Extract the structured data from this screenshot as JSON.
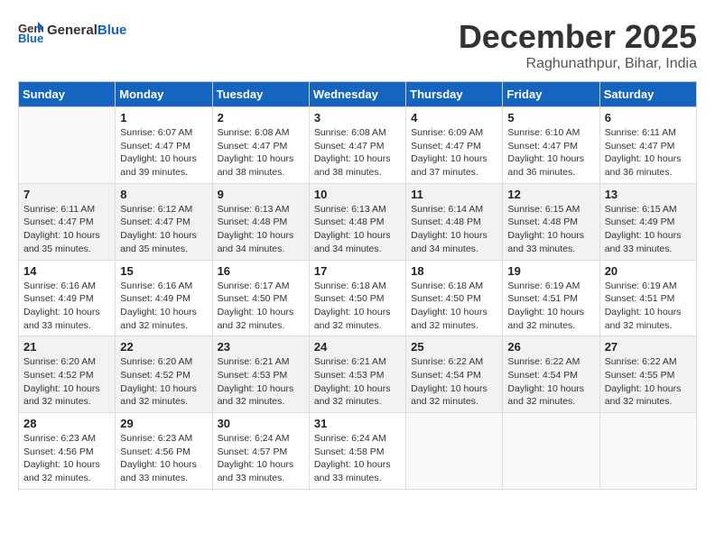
{
  "logo": {
    "general": "General",
    "blue": "Blue"
  },
  "title": "December 2025",
  "location": "Raghunathpur, Bihar, India",
  "weekdays": [
    "Sunday",
    "Monday",
    "Tuesday",
    "Wednesday",
    "Thursday",
    "Friday",
    "Saturday"
  ],
  "weeks": [
    [
      {
        "day": "",
        "sunrise": "",
        "sunset": "",
        "daylight": ""
      },
      {
        "day": "1",
        "sunrise": "Sunrise: 6:07 AM",
        "sunset": "Sunset: 4:47 PM",
        "daylight": "Daylight: 10 hours and 39 minutes."
      },
      {
        "day": "2",
        "sunrise": "Sunrise: 6:08 AM",
        "sunset": "Sunset: 4:47 PM",
        "daylight": "Daylight: 10 hours and 38 minutes."
      },
      {
        "day": "3",
        "sunrise": "Sunrise: 6:08 AM",
        "sunset": "Sunset: 4:47 PM",
        "daylight": "Daylight: 10 hours and 38 minutes."
      },
      {
        "day": "4",
        "sunrise": "Sunrise: 6:09 AM",
        "sunset": "Sunset: 4:47 PM",
        "daylight": "Daylight: 10 hours and 37 minutes."
      },
      {
        "day": "5",
        "sunrise": "Sunrise: 6:10 AM",
        "sunset": "Sunset: 4:47 PM",
        "daylight": "Daylight: 10 hours and 36 minutes."
      },
      {
        "day": "6",
        "sunrise": "Sunrise: 6:11 AM",
        "sunset": "Sunset: 4:47 PM",
        "daylight": "Daylight: 10 hours and 36 minutes."
      }
    ],
    [
      {
        "day": "7",
        "sunrise": "Sunrise: 6:11 AM",
        "sunset": "Sunset: 4:47 PM",
        "daylight": "Daylight: 10 hours and 35 minutes."
      },
      {
        "day": "8",
        "sunrise": "Sunrise: 6:12 AM",
        "sunset": "Sunset: 4:47 PM",
        "daylight": "Daylight: 10 hours and 35 minutes."
      },
      {
        "day": "9",
        "sunrise": "Sunrise: 6:13 AM",
        "sunset": "Sunset: 4:48 PM",
        "daylight": "Daylight: 10 hours and 34 minutes."
      },
      {
        "day": "10",
        "sunrise": "Sunrise: 6:13 AM",
        "sunset": "Sunset: 4:48 PM",
        "daylight": "Daylight: 10 hours and 34 minutes."
      },
      {
        "day": "11",
        "sunrise": "Sunrise: 6:14 AM",
        "sunset": "Sunset: 4:48 PM",
        "daylight": "Daylight: 10 hours and 34 minutes."
      },
      {
        "day": "12",
        "sunrise": "Sunrise: 6:15 AM",
        "sunset": "Sunset: 4:48 PM",
        "daylight": "Daylight: 10 hours and 33 minutes."
      },
      {
        "day": "13",
        "sunrise": "Sunrise: 6:15 AM",
        "sunset": "Sunset: 4:49 PM",
        "daylight": "Daylight: 10 hours and 33 minutes."
      }
    ],
    [
      {
        "day": "14",
        "sunrise": "Sunrise: 6:16 AM",
        "sunset": "Sunset: 4:49 PM",
        "daylight": "Daylight: 10 hours and 33 minutes."
      },
      {
        "day": "15",
        "sunrise": "Sunrise: 6:16 AM",
        "sunset": "Sunset: 4:49 PM",
        "daylight": "Daylight: 10 hours and 32 minutes."
      },
      {
        "day": "16",
        "sunrise": "Sunrise: 6:17 AM",
        "sunset": "Sunset: 4:50 PM",
        "daylight": "Daylight: 10 hours and 32 minutes."
      },
      {
        "day": "17",
        "sunrise": "Sunrise: 6:18 AM",
        "sunset": "Sunset: 4:50 PM",
        "daylight": "Daylight: 10 hours and 32 minutes."
      },
      {
        "day": "18",
        "sunrise": "Sunrise: 6:18 AM",
        "sunset": "Sunset: 4:50 PM",
        "daylight": "Daylight: 10 hours and 32 minutes."
      },
      {
        "day": "19",
        "sunrise": "Sunrise: 6:19 AM",
        "sunset": "Sunset: 4:51 PM",
        "daylight": "Daylight: 10 hours and 32 minutes."
      },
      {
        "day": "20",
        "sunrise": "Sunrise: 6:19 AM",
        "sunset": "Sunset: 4:51 PM",
        "daylight": "Daylight: 10 hours and 32 minutes."
      }
    ],
    [
      {
        "day": "21",
        "sunrise": "Sunrise: 6:20 AM",
        "sunset": "Sunset: 4:52 PM",
        "daylight": "Daylight: 10 hours and 32 minutes."
      },
      {
        "day": "22",
        "sunrise": "Sunrise: 6:20 AM",
        "sunset": "Sunset: 4:52 PM",
        "daylight": "Daylight: 10 hours and 32 minutes."
      },
      {
        "day": "23",
        "sunrise": "Sunrise: 6:21 AM",
        "sunset": "Sunset: 4:53 PM",
        "daylight": "Daylight: 10 hours and 32 minutes."
      },
      {
        "day": "24",
        "sunrise": "Sunrise: 6:21 AM",
        "sunset": "Sunset: 4:53 PM",
        "daylight": "Daylight: 10 hours and 32 minutes."
      },
      {
        "day": "25",
        "sunrise": "Sunrise: 6:22 AM",
        "sunset": "Sunset: 4:54 PM",
        "daylight": "Daylight: 10 hours and 32 minutes."
      },
      {
        "day": "26",
        "sunrise": "Sunrise: 6:22 AM",
        "sunset": "Sunset: 4:54 PM",
        "daylight": "Daylight: 10 hours and 32 minutes."
      },
      {
        "day": "27",
        "sunrise": "Sunrise: 6:22 AM",
        "sunset": "Sunset: 4:55 PM",
        "daylight": "Daylight: 10 hours and 32 minutes."
      }
    ],
    [
      {
        "day": "28",
        "sunrise": "Sunrise: 6:23 AM",
        "sunset": "Sunset: 4:56 PM",
        "daylight": "Daylight: 10 hours and 32 minutes."
      },
      {
        "day": "29",
        "sunrise": "Sunrise: 6:23 AM",
        "sunset": "Sunset: 4:56 PM",
        "daylight": "Daylight: 10 hours and 33 minutes."
      },
      {
        "day": "30",
        "sunrise": "Sunrise: 6:24 AM",
        "sunset": "Sunset: 4:57 PM",
        "daylight": "Daylight: 10 hours and 33 minutes."
      },
      {
        "day": "31",
        "sunrise": "Sunrise: 6:24 AM",
        "sunset": "Sunset: 4:58 PM",
        "daylight": "Daylight: 10 hours and 33 minutes."
      },
      {
        "day": "",
        "sunrise": "",
        "sunset": "",
        "daylight": ""
      },
      {
        "day": "",
        "sunrise": "",
        "sunset": "",
        "daylight": ""
      },
      {
        "day": "",
        "sunrise": "",
        "sunset": "",
        "daylight": ""
      }
    ]
  ]
}
